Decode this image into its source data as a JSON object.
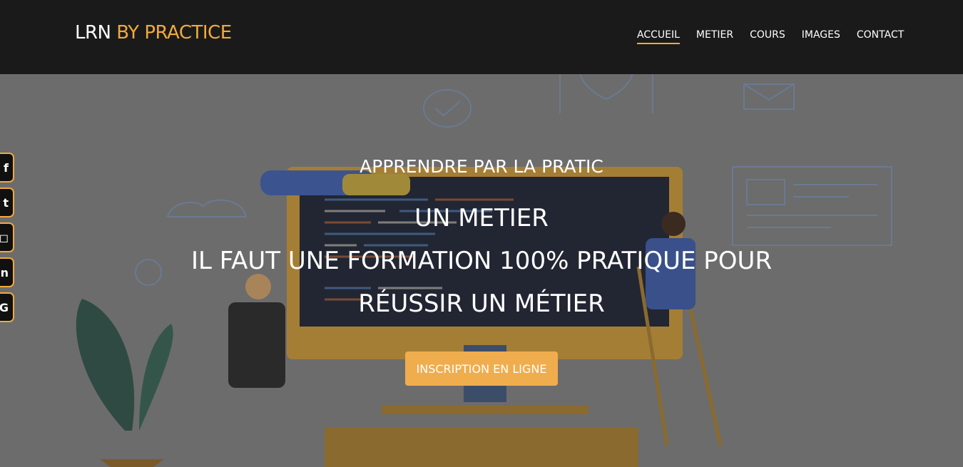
{
  "brand": {
    "name": "LRN",
    "accent": "BY PRACTICE"
  },
  "nav": [
    {
      "label": "ACCUEIL",
      "active": true
    },
    {
      "label": "METIER",
      "active": false
    },
    {
      "label": "COURS",
      "active": false
    },
    {
      "label": "IMAGES",
      "active": false
    },
    {
      "label": "CONTACT",
      "active": false
    }
  ],
  "social": [
    {
      "icon": "facebook-icon",
      "glyph": "f"
    },
    {
      "icon": "twitter-icon",
      "glyph": "t"
    },
    {
      "icon": "instagram-icon",
      "glyph": "◻"
    },
    {
      "icon": "linkedin-icon",
      "glyph": "in"
    },
    {
      "icon": "google-icon",
      "glyph": "G"
    }
  ],
  "hero": {
    "kicker": "APPRENDRE PAR LA PRATIC",
    "line1": "UN METIER",
    "line2": "IL FAUT UNE FORMATION 100% PRATIQUE POUR",
    "line3": "RÉUSSIR UN MÉTIER",
    "cta": "INSCRIPTION EN LIGNE"
  },
  "colors": {
    "accent": "#f2a93b",
    "navbar": "#1a1a1a",
    "button": "#f0ad4e"
  }
}
